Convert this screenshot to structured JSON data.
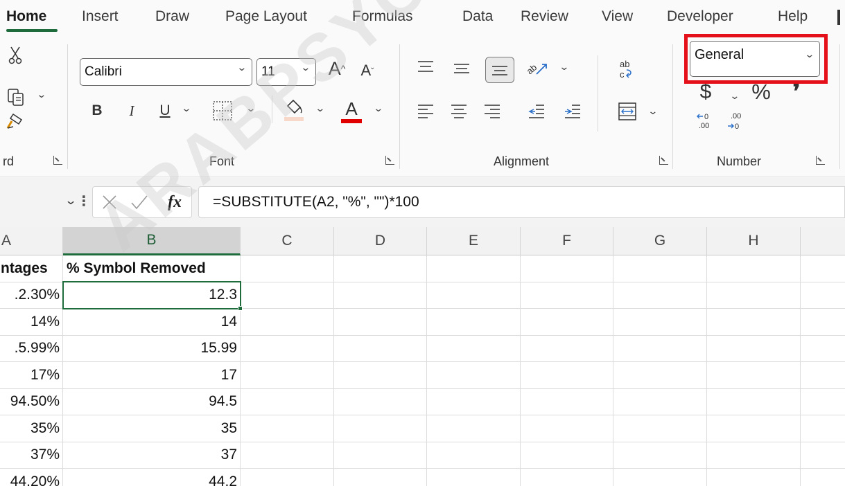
{
  "tabs": [
    {
      "label": "Home",
      "active": true
    },
    {
      "label": "Insert"
    },
    {
      "label": "Draw"
    },
    {
      "label": "Page Layout"
    },
    {
      "label": "Formulas"
    },
    {
      "label": "Data"
    },
    {
      "label": "Review"
    },
    {
      "label": "View"
    },
    {
      "label": "Developer"
    },
    {
      "label": "Help"
    }
  ],
  "ribbon": {
    "clipboard": {
      "label": "rd"
    },
    "font": {
      "label": "Font",
      "family": "Calibri",
      "size": "11",
      "bold_label": "B",
      "italic_label": "I",
      "underline_label": "U",
      "font_color_letter": "A",
      "grow_label": "A",
      "shrink_label": "A",
      "font_color": "#e00000"
    },
    "alignment": {
      "label": "Alignment",
      "wrap_label": "ab c"
    },
    "number": {
      "label": "Number",
      "format": "General",
      "currency_symbol": "$",
      "percent_symbol": "%",
      "comma_symbol": "❜",
      "increase_decimal": "←0 .00",
      "decrease_decimal": ".00 →0"
    },
    "highlight_color": "#e4101a"
  },
  "formula_bar": {
    "fx_label": "fx",
    "formula": "=SUBSTITUTE(A2, \"%\", \"\")*100"
  },
  "grid": {
    "columns": [
      "A",
      "B",
      "C",
      "D",
      "E",
      "F",
      "G",
      "H"
    ],
    "header_row": [
      "ntages",
      "% Symbol Removed"
    ],
    "rows": [
      [
        ".2.30%",
        "12.3"
      ],
      [
        "14%",
        "14"
      ],
      [
        ".5.99%",
        "15.99"
      ],
      [
        "17%",
        "17"
      ],
      [
        "94.50%",
        "94.5"
      ],
      [
        "35%",
        "35"
      ],
      [
        "37%",
        "37"
      ],
      [
        "44.20%",
        "44.2"
      ]
    ],
    "accent_color": "#1e6b3c"
  },
  "watermark": "ARABPSYCHOLOGY"
}
